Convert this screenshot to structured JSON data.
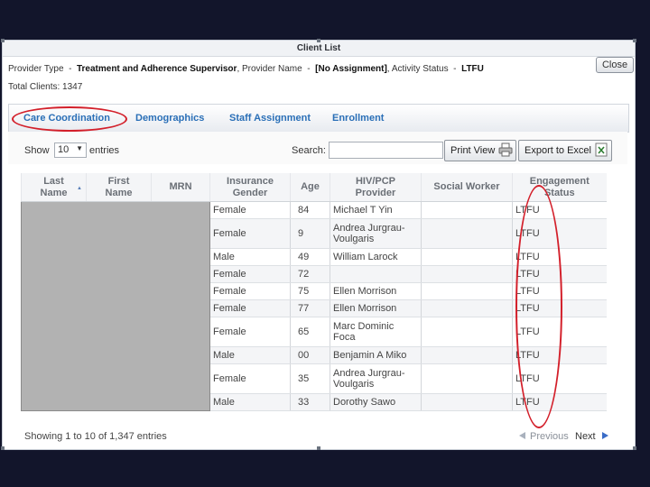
{
  "window": {
    "title": "Client List",
    "close_label": "Close"
  },
  "info": {
    "provider_type_label": "Provider Type",
    "provider_type_value": "Treatment and Adherence Supervisor",
    "provider_name_label": "Provider Name",
    "provider_name_value": "[No Assignment]",
    "activity_status_label": "Activity Status",
    "activity_status_value": "LTFU",
    "total_clients_label": "Total Clients:",
    "total_clients_value": "1347"
  },
  "tabs": [
    {
      "label": "Care Coordination",
      "active": true
    },
    {
      "label": "Demographics"
    },
    {
      "label": "Staff Assignment"
    },
    {
      "label": "Enrollment"
    }
  ],
  "controls": {
    "show_label": "Show",
    "entries_value": "10",
    "entries_label": "entries",
    "search_label": "Search:",
    "search_value": "",
    "print_label": "Print View",
    "export_label": "Export to Excel"
  },
  "table": {
    "headers": [
      {
        "line1": "Last",
        "line2": "Name"
      },
      {
        "line1": "First",
        "line2": "Name"
      },
      {
        "line1": "MRN",
        "line2": ""
      },
      {
        "line1": "Insurance",
        "line2": "Gender"
      },
      {
        "line1": "Age",
        "line2": ""
      },
      {
        "line1": "HIV/PCP",
        "line2": "Provider"
      },
      {
        "line1": "Social Worker",
        "line2": ""
      },
      {
        "line1": "Engagement",
        "line2": "Status"
      }
    ],
    "rows": [
      {
        "gender": "Female",
        "age": "84",
        "provider_l1": "Michael T Yin",
        "provider_l2": "",
        "social_worker": "",
        "status": "LTFU"
      },
      {
        "gender": "Female",
        "age": "9",
        "provider_l1": "Andrea Jurgrau-",
        "provider_l2": "Voulgaris",
        "social_worker": "",
        "status": "LTFU"
      },
      {
        "gender": "Male",
        "age": "49",
        "provider_l1": "William Larock",
        "provider_l2": "",
        "social_worker": "",
        "status": "LTFU"
      },
      {
        "gender": "Female",
        "age": "72",
        "provider_l1": "",
        "provider_l2": "",
        "social_worker": "",
        "status": "LTFU"
      },
      {
        "gender": "Female",
        "age": "75",
        "provider_l1": "Ellen Morrison",
        "provider_l2": "",
        "social_worker": "",
        "status": "LTFU"
      },
      {
        "gender": "Female",
        "age": "77",
        "provider_l1": "Ellen Morrison",
        "provider_l2": "",
        "social_worker": "",
        "status": "LTFU"
      },
      {
        "gender": "Female",
        "age": "65",
        "provider_l1": "Marc Dominic",
        "provider_l2": "Foca",
        "social_worker": "",
        "status": "LTFU"
      },
      {
        "gender": "Male",
        "age": "00",
        "provider_l1": "Benjamin A Miko",
        "provider_l2": "",
        "social_worker": "",
        "status": "LTFU"
      },
      {
        "gender": "Female",
        "age": "35",
        "provider_l1": "Andrea Jurgrau-",
        "provider_l2": "Voulgaris",
        "social_worker": "",
        "status": "LTFU"
      },
      {
        "gender": "Male",
        "age": "33",
        "provider_l1": "Dorothy Sawo",
        "provider_l2": "",
        "social_worker": "",
        "status": "LTFU"
      }
    ]
  },
  "footer": {
    "showing": "Showing 1 to 10 of 1,347 entries",
    "previous": "Previous",
    "next": "Next"
  },
  "colors": {
    "accent_link": "#2a6fb7",
    "annotation_red": "#d31f2a",
    "background": "#12152b"
  }
}
